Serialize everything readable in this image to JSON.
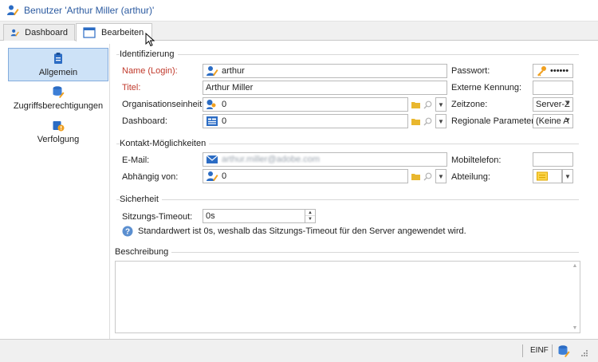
{
  "window": {
    "title": "Benutzer 'Arthur Miller (arthur)'"
  },
  "tabs": [
    {
      "label": "Dashboard",
      "icon": "user-pen-icon"
    },
    {
      "label": "Bearbeiten",
      "icon": "edit-window-icon"
    }
  ],
  "nav": [
    {
      "label": "Allgemein",
      "icon": "clipboard-icon"
    },
    {
      "label": "Zugriffsberechtigungen",
      "icon": "database-user-icon"
    },
    {
      "label": "Verfolgung",
      "icon": "tracking-icon"
    }
  ],
  "identification": {
    "group_title": "Identifizierung",
    "name_label": "Name (Login):",
    "name_value": "arthur",
    "title_label": "Titel:",
    "title_value": "Arthur Miller",
    "org_label": "Organisationseinheit:",
    "org_value": "0",
    "dashboard_label": "Dashboard:",
    "dashboard_value": "0",
    "password_label": "Passwort:",
    "password_value": "••••••",
    "external_id_label": "Externe Kennung:",
    "external_id_value": "",
    "timezone_label": "Zeitzone:",
    "timezone_value": "Server-Z",
    "regional_label": "Regionale Parameter:",
    "regional_value": "(Keine A"
  },
  "contact": {
    "group_title": "Kontakt-Möglichkeiten",
    "email_label": "E-Mail:",
    "email_value": "arthur.miller@adobe.com",
    "depends_label": "Abhängig von:",
    "depends_value": "0",
    "mobile_label": "Mobiltelefon:",
    "mobile_value": "",
    "department_label": "Abteilung:"
  },
  "security": {
    "group_title": "Sicherheit",
    "timeout_label": "Sitzungs-Timeout:",
    "timeout_value": "0s",
    "info_text": "Standardwert ist 0s, weshalb das Sitzungs-Timeout für den Server angewendet wird."
  },
  "description": {
    "group_title": "Beschreibung",
    "value": ""
  },
  "status": {
    "locale": "EINF"
  },
  "colors": {
    "accent": "#2b5aa0",
    "required": "#c0392b",
    "selection": "#cde2f7"
  }
}
